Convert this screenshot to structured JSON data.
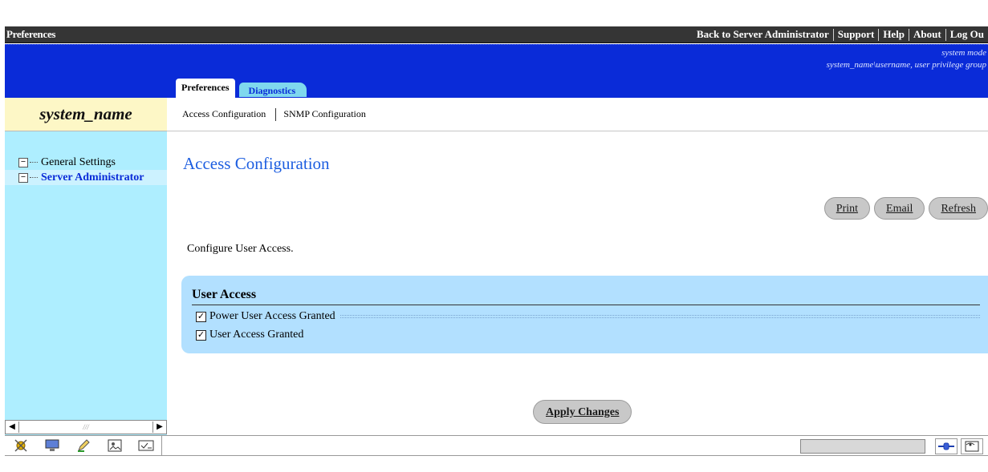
{
  "topbar": {
    "brand": "Preferences",
    "links": [
      "Back to Server Administrator",
      "Support",
      "Help",
      "About",
      "Log Ou"
    ]
  },
  "header": {
    "mode_text": "system mode",
    "user_text": "system_name\\username, user privilege group",
    "tabs": [
      {
        "label": "Preferences",
        "active": true
      },
      {
        "label": "Diagnostics",
        "active": false
      }
    ]
  },
  "sidebar": {
    "system_name": "system_name",
    "tree": [
      {
        "label": "General Settings",
        "selected": false
      },
      {
        "label": "Server Administrator",
        "selected": true
      }
    ]
  },
  "subnav": {
    "items": [
      "Access Configuration",
      "SNMP Configuration"
    ]
  },
  "page": {
    "title": "Access Configuration",
    "actions": [
      "Print",
      "Email",
      "Refresh"
    ],
    "intro": "Configure User Access.",
    "section_title": "User Access",
    "checkboxes": [
      {
        "label": "Power User Access Granted",
        "checked": true
      },
      {
        "label": "User Access Granted",
        "checked": true
      }
    ],
    "apply_label": "Apply Changes"
  },
  "statusbar": {
    "icons": [
      "wrench-tools-icon",
      "monitor-icon",
      "edit-icon",
      "image-icon",
      "check-icon"
    ],
    "progress_fraction": 0
  },
  "colors": {
    "header_blue": "#0a2bd8",
    "sidebar_cyan": "#aeeeff",
    "panel_blue": "#b2e0ff",
    "title_blue": "#1d5ee0"
  }
}
